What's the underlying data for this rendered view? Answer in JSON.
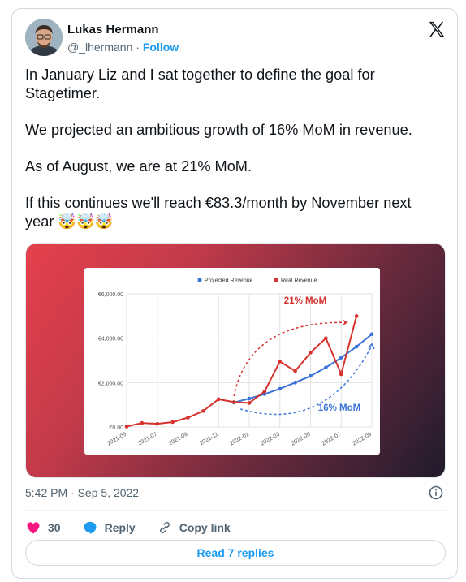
{
  "author": {
    "name": "Lukas Hermann",
    "handle": "@_lhermann",
    "separator": "·",
    "follow_label": "Follow"
  },
  "tweet": {
    "paragraphs": [
      "In January Liz and I sat together to define the goal for Stagetimer.",
      "We projected an ambitious growth of 16% MoM in revenue.",
      "As of August, we are at 21% MoM.",
      "If this continues we'll reach €83.3/month by November next year 🤯🤯🤯"
    ]
  },
  "footer": {
    "timestamp": "5:42 PM · Sep 5, 2022"
  },
  "actions": {
    "like_count": "30",
    "reply_label": "Reply",
    "copy_link_label": "Copy link"
  },
  "read_replies_label": "Read 7 replies",
  "colors": {
    "accent": "#1d9bf0",
    "like": "#f91880",
    "projected": "#3b73d6",
    "real": "#d6322e"
  },
  "chart_data": {
    "type": "line",
    "x": [
      "2021-05",
      "2021-06",
      "2021-07",
      "2021-08",
      "2021-09",
      "2021-10",
      "2021-11",
      "2021-12",
      "2022-01",
      "2022-02",
      "2022-03",
      "2022-04",
      "2022-05",
      "2022-06",
      "2022-07",
      "2022-08",
      "2022-09"
    ],
    "xtick_labels": [
      "2021-05",
      "2021-07",
      "2021-09",
      "2021-11",
      "2022-01",
      "2022-03",
      "2022-05",
      "2022-07",
      "2022-09"
    ],
    "yticks": [
      "€0.00",
      "€2,000.00",
      "€4,000.00",
      "€6,000.00"
    ],
    "ylim": [
      0,
      6000
    ],
    "grid": true,
    "legend_position": "top",
    "series": [
      {
        "name": "Projected Revenue",
        "color": "#3b73d6",
        "start_index": 7,
        "values": [
          1100,
          1280,
          1480,
          1720,
          2000,
          2300,
          2680,
          3120,
          3620,
          4180
        ]
      },
      {
        "name": "Real Revenue",
        "color": "#d6322e",
        "start_index": 0,
        "values": [
          20,
          180,
          140,
          220,
          420,
          720,
          1250,
          1120,
          1080,
          1600,
          2950,
          2520,
          3350,
          4000,
          2380,
          5000
        ]
      }
    ],
    "annotations": [
      {
        "text": "21% MoM",
        "color": "#d6322e"
      },
      {
        "text": "16% MoM",
        "color": "#3b73d6"
      }
    ]
  }
}
